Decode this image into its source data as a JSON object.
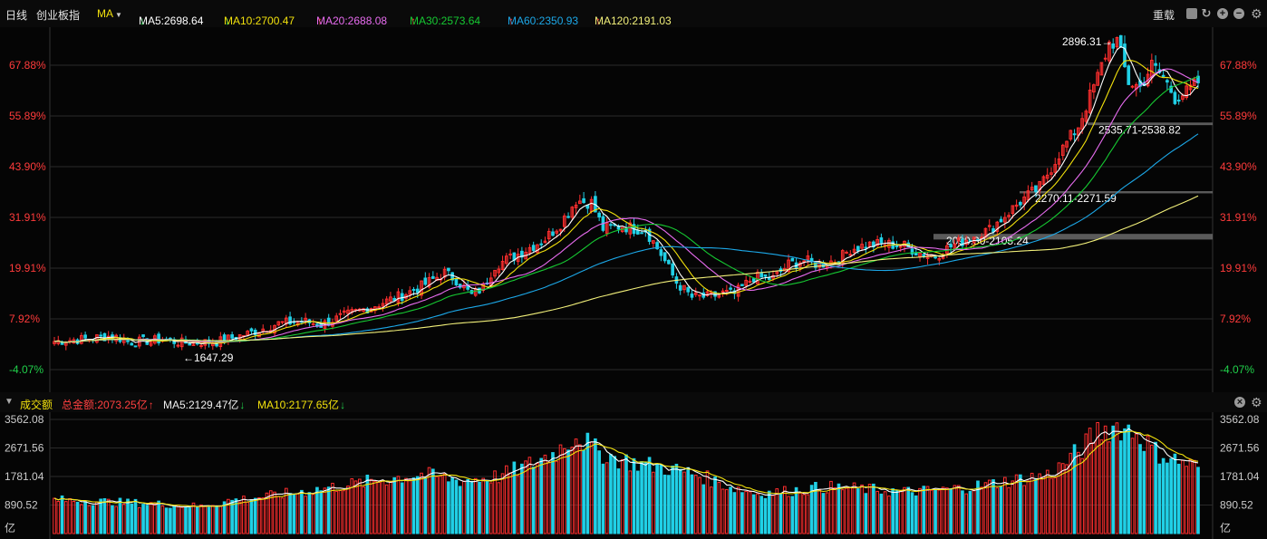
{
  "toolbar": {
    "period_label": "日线",
    "index_name": "创业板指",
    "indicator_label": "MA",
    "rehab_label": "重载",
    "ma_values": [
      {
        "label": "MA5:2698.64",
        "dir": "down",
        "color": "#ffffff"
      },
      {
        "label": "MA10:2700.47",
        "dir": "down",
        "color": "#f2e10c"
      },
      {
        "label": "MA20:2688.08",
        "dir": "up",
        "color": "#e86cf0"
      },
      {
        "label": "MA30:2573.64",
        "dir": "up",
        "color": "#16c932"
      },
      {
        "label": "MA60:2350.93",
        "dir": "up",
        "color": "#1ca8e8"
      },
      {
        "label": "MA120:2191.03",
        "dir": "up",
        "color": "#f2f07a"
      }
    ]
  },
  "volume_header": {
    "title": "成交额",
    "total_label": "总金额:2073.25亿",
    "total_dir": "up",
    "ma5_label": "MA5:2129.47亿",
    "ma5_dir": "down",
    "ma10_label": "MA10:2177.65亿",
    "ma10_dir": "down"
  },
  "colors": {
    "up": "#ff2e2e",
    "down": "#21d0e6",
    "grid": "#2a2a2a",
    "bg": "#050505"
  },
  "chart_data": [
    {
      "type": "candlestick",
      "title": "创业板指 日线",
      "yaxis_pct_labels": [
        "67.88%",
        "55.89%",
        "43.90%",
        "31.91%",
        "19.91%",
        "7.92%",
        "-4.07%"
      ],
      "annotations": {
        "high": "2896.31→",
        "low": "←1647.29",
        "zone_labels": [
          "2535.71-2538.82",
          "2270.11-2271.59",
          "2090.30-2105.24"
        ]
      },
      "series": [
        {
          "name": "MA5",
          "value": 2698.64
        },
        {
          "name": "MA10",
          "value": 2700.47
        },
        {
          "name": "MA20",
          "value": 2688.08
        },
        {
          "name": "MA30",
          "value": 2573.64
        },
        {
          "name": "MA60",
          "value": 2350.93
        },
        {
          "name": "MA120",
          "value": 2191.03
        }
      ],
      "close_path": [
        [
          0,
          1690
        ],
        [
          8,
          1700
        ],
        [
          15,
          1712
        ],
        [
          20,
          1688
        ],
        [
          28,
          1697
        ],
        [
          33,
          1685
        ],
        [
          42,
          1688
        ],
        [
          50,
          1720
        ],
        [
          58,
          1760
        ],
        [
          64,
          1770
        ],
        [
          69,
          1755
        ],
        [
          75,
          1790
        ],
        [
          82,
          1825
        ],
        [
          90,
          1870
        ],
        [
          95,
          1905
        ],
        [
          101,
          1958
        ],
        [
          104,
          1930
        ],
        [
          108,
          1870
        ],
        [
          111,
          1900
        ],
        [
          114,
          1985
        ],
        [
          120,
          2030
        ],
        [
          127,
          2090
        ],
        [
          131,
          2150
        ],
        [
          135,
          2240
        ],
        [
          139,
          2230
        ],
        [
          142,
          2130
        ],
        [
          147,
          2140
        ],
        [
          150,
          2130
        ],
        [
          153,
          2125
        ],
        [
          157,
          2030
        ],
        [
          161,
          1920
        ],
        [
          165,
          1862
        ],
        [
          170,
          1865
        ],
        [
          173,
          1878
        ],
        [
          176,
          1875
        ],
        [
          181,
          1940
        ],
        [
          186,
          1935
        ],
        [
          190,
          1990
        ],
        [
          194,
          2005
        ],
        [
          198,
          1990
        ],
        [
          203,
          2010
        ],
        [
          206,
          2050
        ],
        [
          210,
          2065
        ],
        [
          215,
          2070
        ],
        [
          220,
          2062
        ],
        [
          224,
          2035
        ],
        [
          228,
          2025
        ],
        [
          232,
          2060
        ],
        [
          237,
          2095
        ],
        [
          242,
          2125
        ],
        [
          246,
          2180
        ],
        [
          250,
          2235
        ],
        [
          255,
          2290
        ],
        [
          260,
          2420
        ],
        [
          265,
          2530
        ],
        [
          270,
          2720
        ],
        [
          273,
          2850
        ],
        [
          275,
          2860
        ],
        [
          278,
          2700
        ],
        [
          281,
          2680
        ],
        [
          284,
          2765
        ],
        [
          287,
          2720
        ],
        [
          290,
          2640
        ],
        [
          293,
          2660
        ],
        [
          296,
          2700
        ]
      ],
      "yaxis_price_ref": {
        "base": 1647.29
      }
    },
    {
      "type": "bar",
      "title": "成交额",
      "yaxis_labels": [
        "3562.08",
        "2671.56",
        "1781.04",
        "890.52",
        "亿"
      ],
      "unit": "亿",
      "ylim": [
        0,
        3562.08
      ],
      "series": [
        {
          "name": "总金额",
          "value": 2073.25
        },
        {
          "name": "MA5",
          "value": 2129.47
        },
        {
          "name": "MA10",
          "value": 2177.65
        }
      ],
      "volume_path": [
        [
          0,
          1050
        ],
        [
          15,
          980
        ],
        [
          30,
          900
        ],
        [
          38,
          840
        ],
        [
          45,
          1020
        ],
        [
          55,
          1160
        ],
        [
          65,
          1320
        ],
        [
          75,
          1500
        ],
        [
          85,
          1680
        ],
        [
          95,
          1850
        ],
        [
          105,
          1650
        ],
        [
          115,
          1780
        ],
        [
          122,
          2100
        ],
        [
          130,
          2550
        ],
        [
          135,
          3100
        ],
        [
          140,
          2600
        ],
        [
          145,
          2350
        ],
        [
          150,
          2200
        ],
        [
          158,
          2050
        ],
        [
          166,
          1850
        ],
        [
          175,
          1450
        ],
        [
          182,
          1250
        ],
        [
          190,
          1320
        ],
        [
          200,
          1450
        ],
        [
          210,
          1380
        ],
        [
          220,
          1300
        ],
        [
          230,
          1350
        ],
        [
          240,
          1500
        ],
        [
          250,
          1700
        ],
        [
          258,
          1850
        ],
        [
          266,
          2650
        ],
        [
          270,
          3200
        ],
        [
          275,
          3350
        ],
        [
          280,
          3150
        ],
        [
          285,
          2550
        ],
        [
          290,
          2300
        ],
        [
          296,
          2073
        ]
      ]
    }
  ]
}
